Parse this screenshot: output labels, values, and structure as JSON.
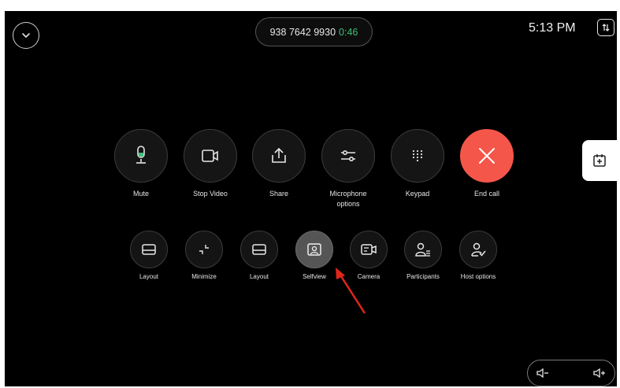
{
  "header": {
    "meeting_number": "938 7642 9930",
    "call_timer": "0:46",
    "clock": "5:13 PM"
  },
  "primary_controls": [
    {
      "label": "Mute",
      "icon": "microphone-icon"
    },
    {
      "label": "Stop Video",
      "icon": "video-camera-icon"
    },
    {
      "label": "Share",
      "icon": "share-icon"
    },
    {
      "label": "Microphone options",
      "icon": "sliders-icon"
    },
    {
      "label": "Keypad",
      "icon": "keypad-icon"
    },
    {
      "label": "End call",
      "icon": "close-icon"
    }
  ],
  "secondary_controls": [
    {
      "label": "Layout",
      "icon": "layout-icon"
    },
    {
      "label": "Minimize",
      "icon": "minimize-icon"
    },
    {
      "label": "Layout",
      "icon": "layout-icon"
    },
    {
      "label": "Selfview",
      "icon": "selfview-icon",
      "active": true
    },
    {
      "label": "Camera",
      "icon": "camera-icon"
    },
    {
      "label": "Participants",
      "icon": "participants-icon"
    },
    {
      "label": "Host options",
      "icon": "host-options-icon"
    }
  ],
  "colors": {
    "background": "#000000",
    "end_call": "#f5564a",
    "timer": "#3fbf7a",
    "annotation_arrow": "#e0261b"
  }
}
